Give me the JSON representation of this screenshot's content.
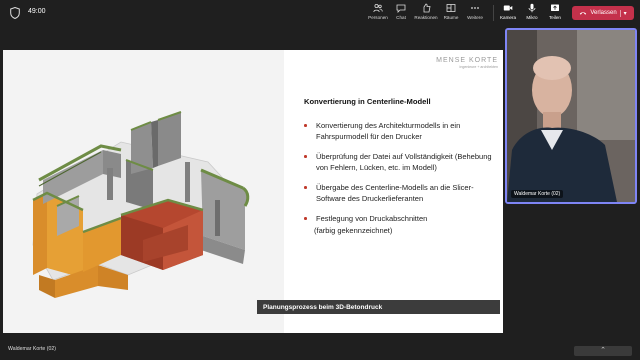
{
  "meeting": {
    "timer": "49:00",
    "toolbar": [
      {
        "label": "Personen",
        "icon": "people-icon"
      },
      {
        "label": "Chat",
        "icon": "chat-icon"
      },
      {
        "label": "Reaktionen",
        "icon": "reaction-icon"
      },
      {
        "label": "Räume",
        "icon": "rooms-icon"
      },
      {
        "label": "Weitere",
        "icon": "more-icon"
      },
      {
        "label": "Kamera",
        "icon": "camera-icon"
      },
      {
        "label": "Mikro",
        "icon": "mic-icon"
      },
      {
        "label": "Teilen",
        "icon": "share-icon"
      }
    ],
    "leave_label": "Verlassen",
    "accent": "#c4314b"
  },
  "slide": {
    "logo_line1": "MENSE KORTE",
    "logo_line2": "ingenieure + architekten",
    "title": "Konvertierung in Centerline-Modell",
    "bullets": [
      "Konvertierung des Architekturmodells in ein Fahrspurmodell für den Drucker",
      "Überprüfung der Datei auf Vollständigkeit (Behebung von Fehlern, Lücken, etc. im Modell)",
      "Übergabe des Centerline-Modells an die Slicer-Software des Druckerlieferanten",
      "Festlegung von Druckabschnitten"
    ],
    "bullet_note": "(farbig gekennzeichnet)",
    "caption": "Planungsprozess beim 3D-Betondruck"
  },
  "presenter_label": "Waldemar Korte (02)",
  "video": {
    "name": "Waldemar Korte (02)",
    "border_color": "#7f85f5"
  }
}
